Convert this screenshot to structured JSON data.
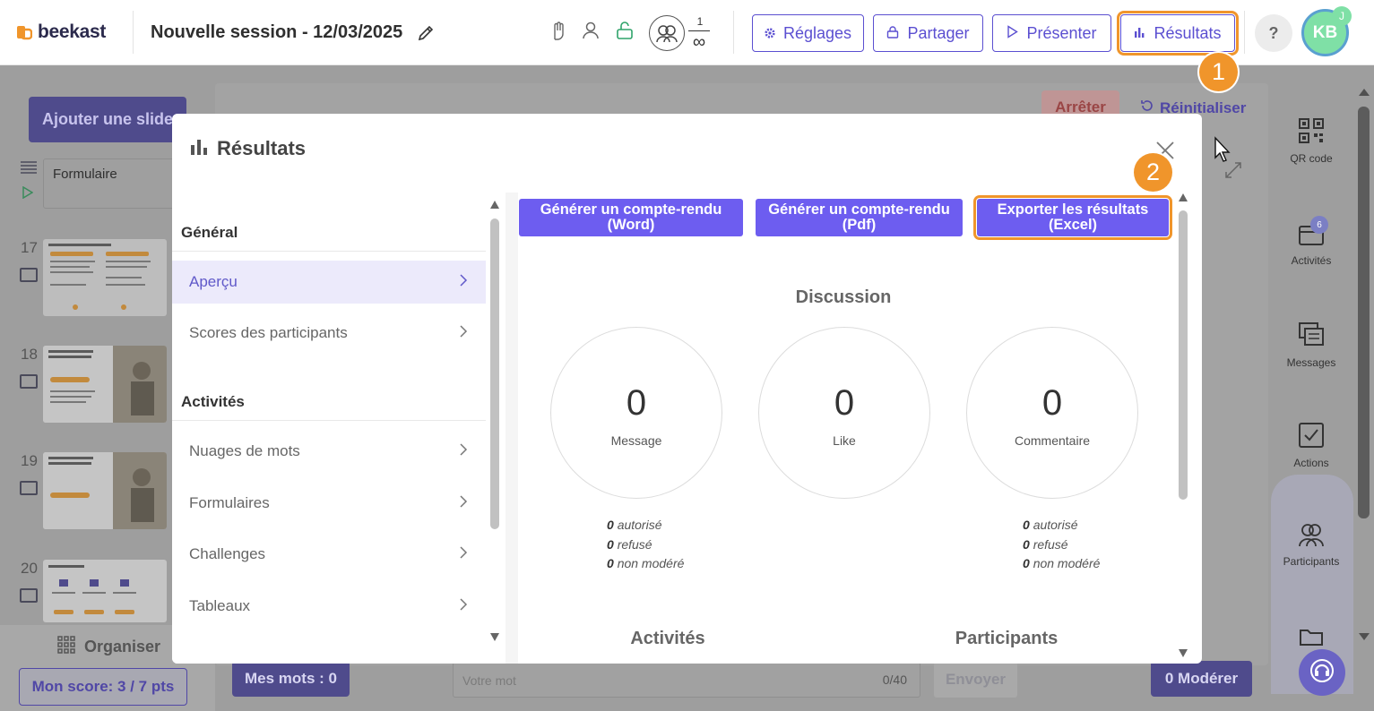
{
  "app": {
    "logo_text": "beekast",
    "session_title": "Nouvelle session - 12/03/2025"
  },
  "header": {
    "participants_count": "1",
    "participants_max": "∞",
    "buttons": {
      "settings": "Réglages",
      "share": "Partager",
      "present": "Présenter",
      "results": "Résultats"
    },
    "help": "?",
    "avatar_initials": "KB",
    "avatar_badge": "J"
  },
  "steps": {
    "one": "1",
    "two": "2"
  },
  "background": {
    "add_slide": "Ajouter une slide",
    "stop": "Arrêter",
    "reset": "Réinitialiser",
    "slides": [
      {
        "label": "Formulaire"
      },
      {
        "num": "17"
      },
      {
        "num": "18"
      },
      {
        "num": "19"
      },
      {
        "num": "20"
      }
    ],
    "organize": "Organiser",
    "score": "Mon score: 3 / 7 pts",
    "my_words": "Mes mots : 0",
    "word_placeholder": "Votre mot",
    "word_count": "0/40",
    "send": "Envoyer",
    "moderate": "0 Modérer",
    "right_panel": [
      {
        "label": "QR code",
        "icon": "qr-code-icon"
      },
      {
        "label": "Activités",
        "icon": "activities-icon",
        "badge": "6"
      },
      {
        "label": "Messages",
        "icon": "messages-icon"
      },
      {
        "label": "Actions",
        "icon": "actions-icon"
      },
      {
        "label": "Participants",
        "icon": "participants-icon"
      }
    ]
  },
  "modal": {
    "title": "Résultats",
    "nav": {
      "general_heading": "Général",
      "general_items": [
        {
          "label": "Aperçu",
          "active": true
        },
        {
          "label": "Scores des participants",
          "active": false
        }
      ],
      "activities_heading": "Activités",
      "activities_items": [
        {
          "label": "Nuages de mots"
        },
        {
          "label": "Formulaires"
        },
        {
          "label": "Challenges"
        },
        {
          "label": "Tableaux"
        }
      ]
    },
    "actions": {
      "report_word": "Générer un compte-rendu (Word)",
      "report_pdf": "Générer un compte-rendu (Pdf)",
      "export_excel": "Exporter les résultats (Excel)"
    },
    "discussion": {
      "title": "Discussion",
      "stats": [
        {
          "value": "0",
          "label": "Message"
        },
        {
          "value": "0",
          "label": "Like"
        },
        {
          "value": "0",
          "label": "Commentaire"
        }
      ],
      "message_moderation": [
        {
          "value": "0",
          "label": "autorisé"
        },
        {
          "value": "0",
          "label": "refusé"
        },
        {
          "value": "0",
          "label": "non modéré"
        }
      ],
      "comment_moderation": [
        {
          "value": "0",
          "label": "autorisé"
        },
        {
          "value": "0",
          "label": "refusé"
        },
        {
          "value": "0",
          "label": "non modéré"
        }
      ]
    },
    "bottom_sections": {
      "activities": "Activités",
      "participants": "Participants"
    }
  },
  "colors": {
    "brand": "#5b4fd1",
    "primary_button": "#6d5df0",
    "highlight": "#f0952b",
    "active_nav_bg": "#eceafb"
  }
}
